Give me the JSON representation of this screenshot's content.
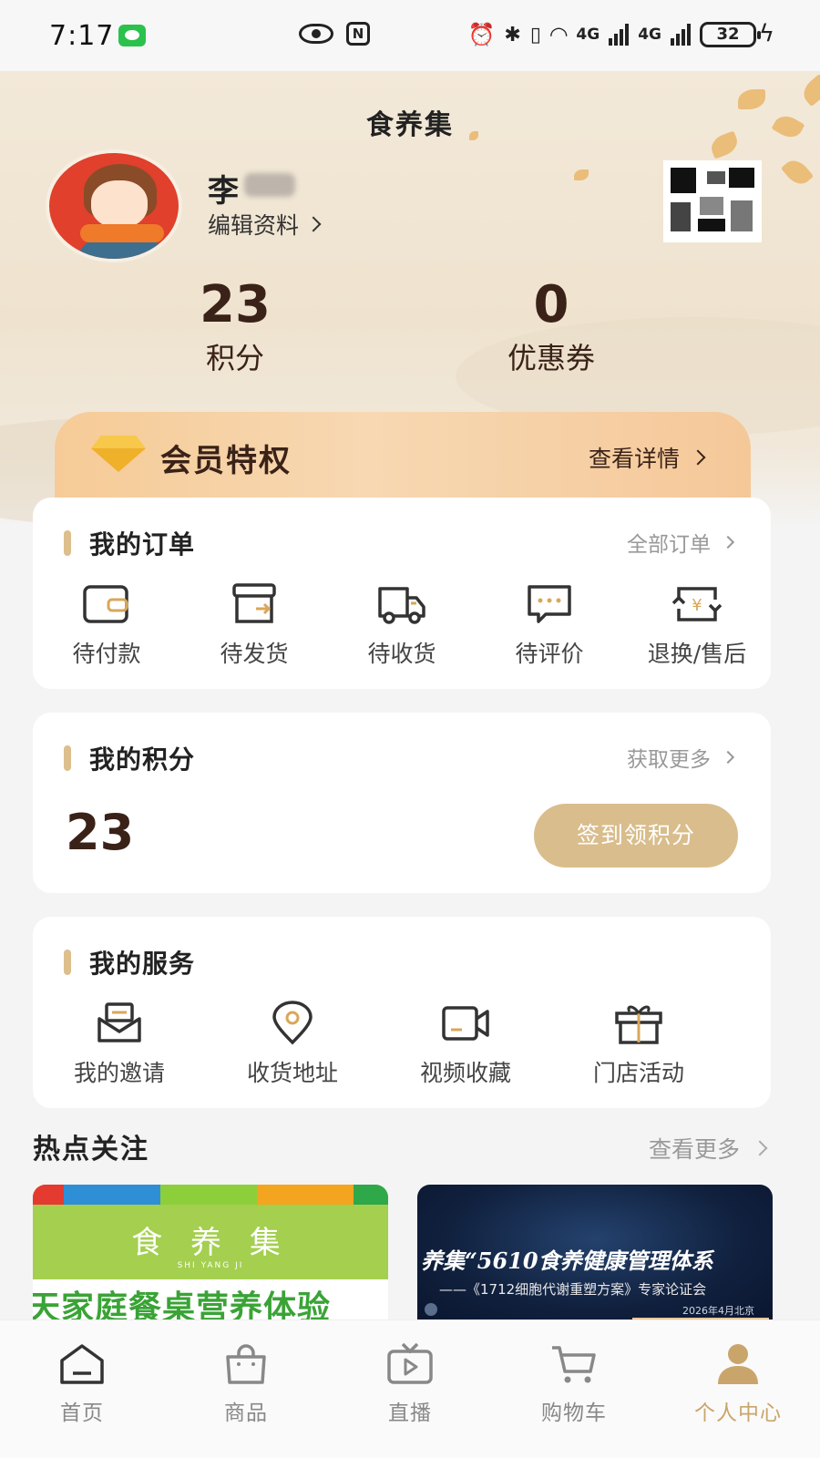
{
  "status_bar": {
    "time": "7:17",
    "network_1": "4G",
    "network_2": "4G",
    "battery": "32"
  },
  "header": {
    "title": "食养集",
    "user": {
      "name": "李",
      "edit_label": "编辑资料"
    },
    "stats": {
      "points_value": "23",
      "points_label": "积分",
      "coupons_value": "0",
      "coupons_label": "优惠券"
    }
  },
  "member": {
    "title": "会员特权",
    "detail_label": "查看详情"
  },
  "orders": {
    "title": "我的订单",
    "link": "全部订单",
    "items": [
      {
        "label": "待付款",
        "icon": "wallet-icon"
      },
      {
        "label": "待发货",
        "icon": "package-icon"
      },
      {
        "label": "待收货",
        "icon": "truck-icon"
      },
      {
        "label": "待评价",
        "icon": "comment-icon"
      },
      {
        "label": "退换/售后",
        "icon": "yen-exchange-icon"
      }
    ]
  },
  "points": {
    "title": "我的积分",
    "link": "获取更多",
    "value": "23",
    "checkin_label": "签到领积分"
  },
  "services": {
    "title": "我的服务",
    "items": [
      {
        "label": "我的邀请",
        "icon": "envelope-icon"
      },
      {
        "label": "收货地址",
        "icon": "location-pin-icon"
      },
      {
        "label": "视频收藏",
        "icon": "video-camera-icon"
      },
      {
        "label": "门店活动",
        "icon": "gift-box-icon"
      }
    ]
  },
  "hot": {
    "title": "热点关注",
    "more": "查看更多",
    "banner1": {
      "logo": "食 养 集",
      "sub": "SHI YANG JI",
      "slogan": "天家庭餐桌营养体验"
    },
    "banner2": {
      "headline": "养集“5610食养健康管理体系",
      "subline": "——《1712细胞代谢重塑方案》专家论证会",
      "date": "2026年4月北京"
    }
  },
  "nav": {
    "active_color": "#c9a56c",
    "items": [
      {
        "label": "首页",
        "icon": "home-icon"
      },
      {
        "label": "商品",
        "icon": "shopping-bag-icon"
      },
      {
        "label": "直播",
        "icon": "tv-play-icon"
      },
      {
        "label": "购物车",
        "icon": "cart-icon"
      },
      {
        "label": "个人中心",
        "icon": "person-icon"
      }
    ]
  },
  "colors": {
    "accent": "#d9bd8c",
    "dark_brown": "#3a2218",
    "member_gold": "#f6cb97"
  }
}
